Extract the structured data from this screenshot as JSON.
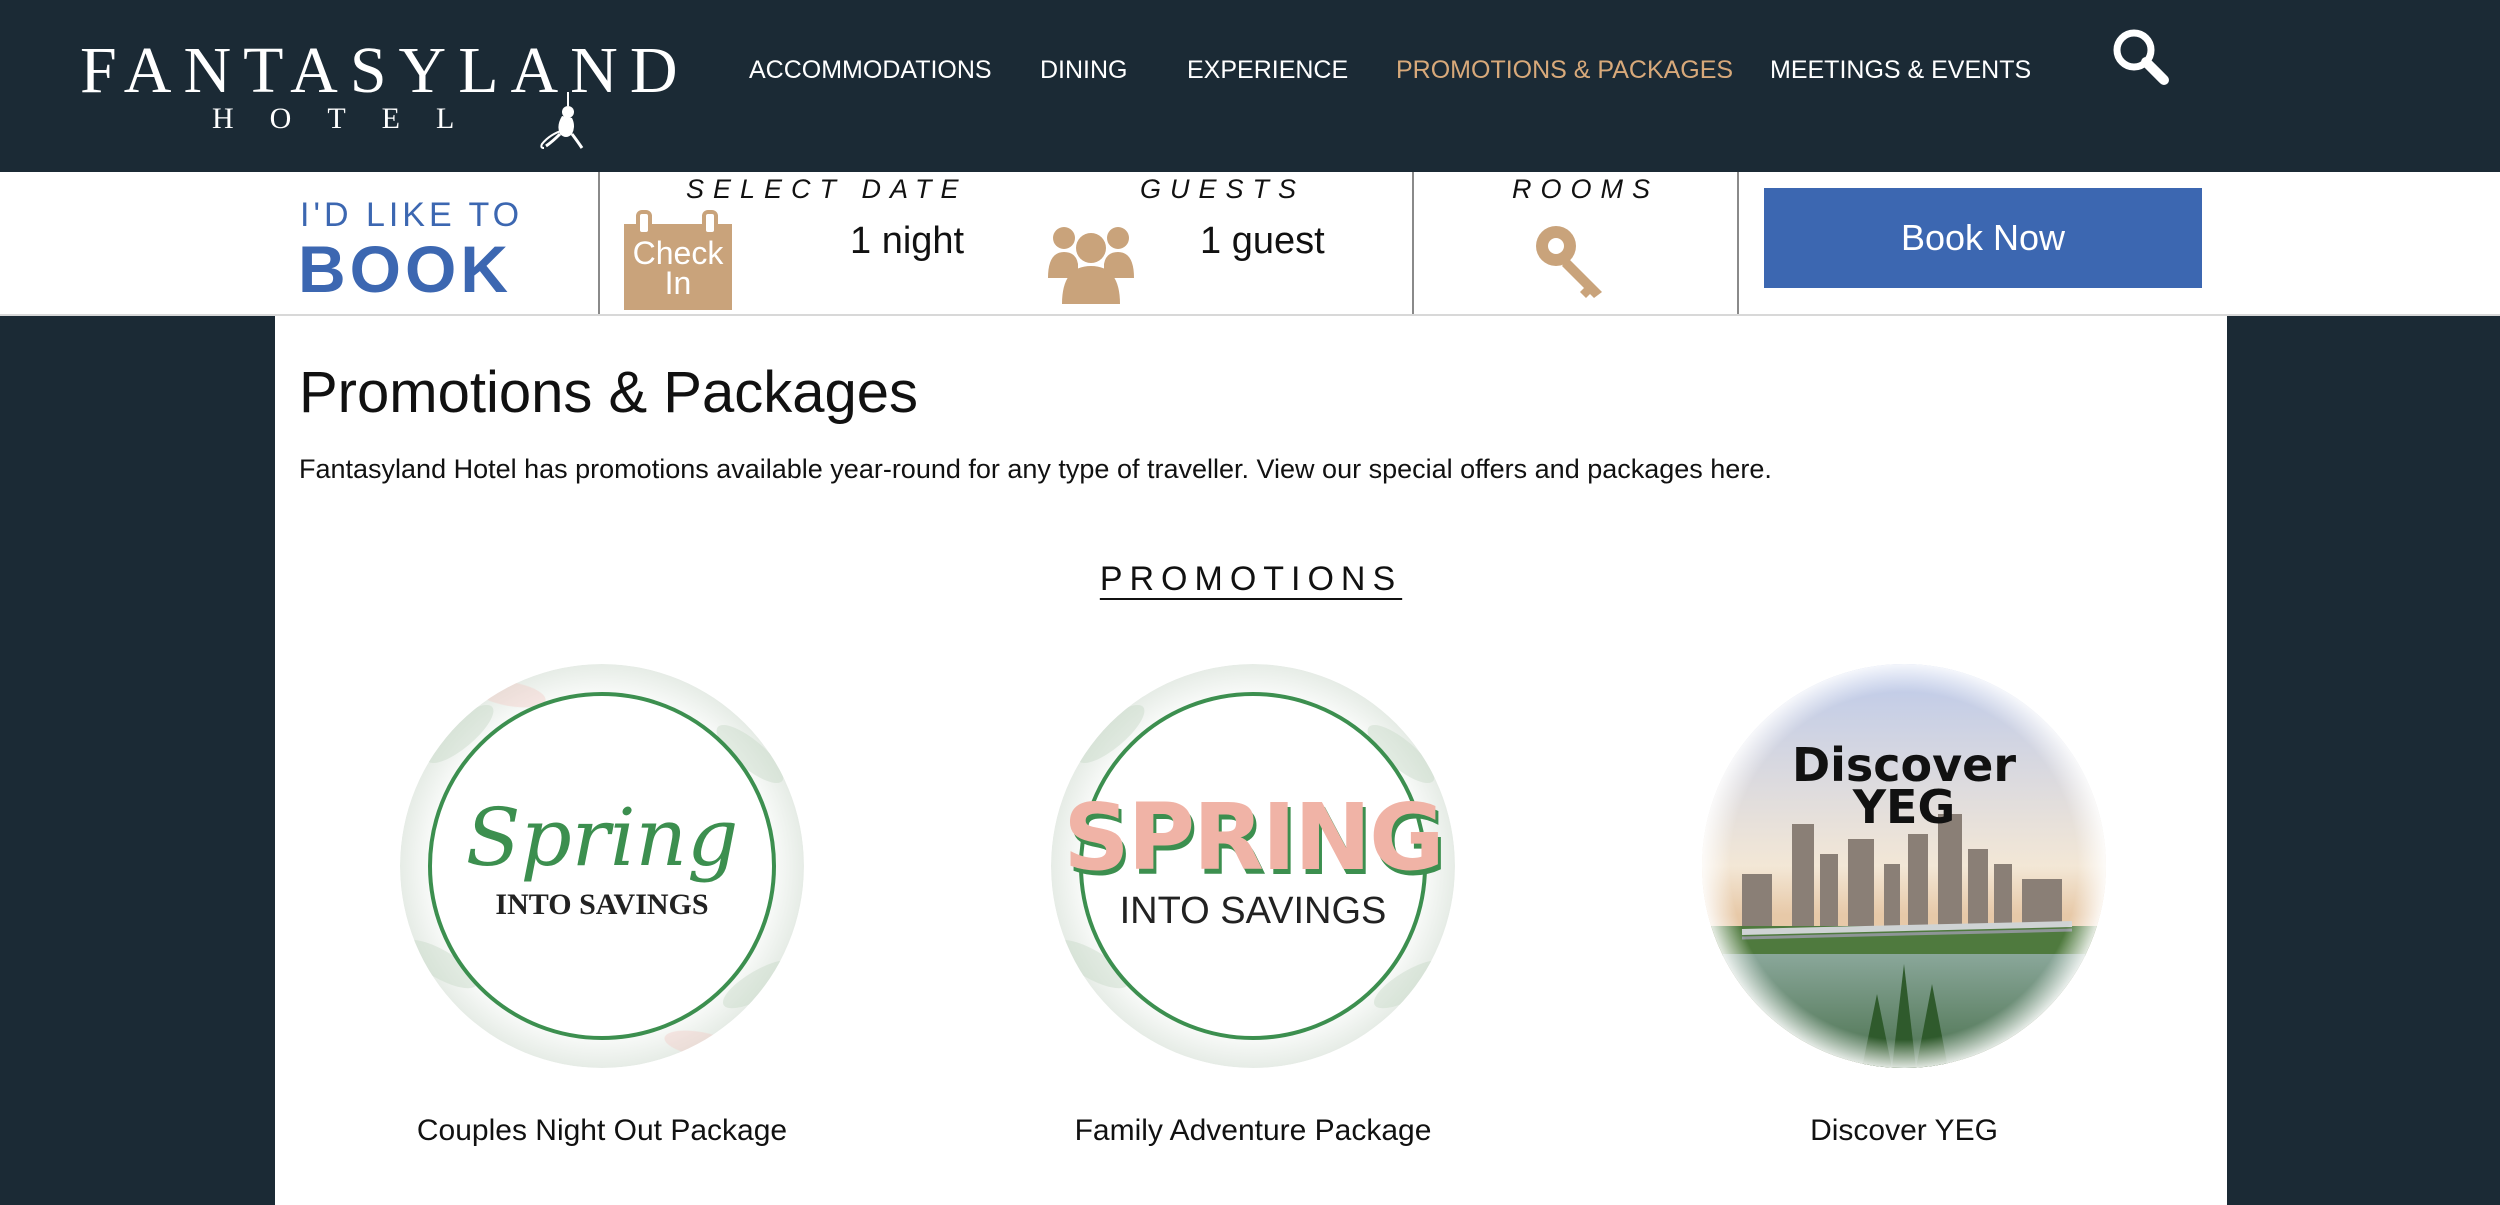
{
  "brand": {
    "name": "FANTASYLAND",
    "sub": "HOTEL"
  },
  "nav": {
    "items": [
      {
        "label": "ACCOMMODATIONS"
      },
      {
        "label": "DINING"
      },
      {
        "label": "EXPERIENCE"
      },
      {
        "label": "PROMOTIONS & PACKAGES",
        "active": true
      },
      {
        "label": "MEETINGS & EVENTS"
      }
    ],
    "search_icon": "search-icon"
  },
  "booking": {
    "prefix": "I'D LIKE TO",
    "title": "BOOK",
    "select_date_label": "SELECT DATE",
    "check_in_label": "Check In",
    "nights_value": "1 night",
    "guests_label": "GUESTS",
    "guests_value": "1 guest",
    "rooms_label": "ROOMS",
    "book_now_label": "Book Now"
  },
  "main": {
    "title": "Promotions & Packages",
    "intro": "Fantasyland Hotel has promotions available year-round for any type of traveller. View our special offers and packages here.",
    "section_heading": "PROMOTIONS",
    "promotions": [
      {
        "label": "Couples Night Out Package",
        "img_text_script": "Spring",
        "img_text_sub": "INTO SAVINGS"
      },
      {
        "label": "Family Adventure Package",
        "img_text_script": "SPRING",
        "img_text_sub": "INTO SAVINGS"
      },
      {
        "label": "Discover YEG",
        "img_text_script": "Discover",
        "img_text_sub": "YEG"
      }
    ]
  },
  "colors": {
    "header_bg": "#1b2a35",
    "accent_blue": "#3c67b1",
    "accent_gold": "#d8a97a",
    "icon_tan": "#c9a37b"
  }
}
